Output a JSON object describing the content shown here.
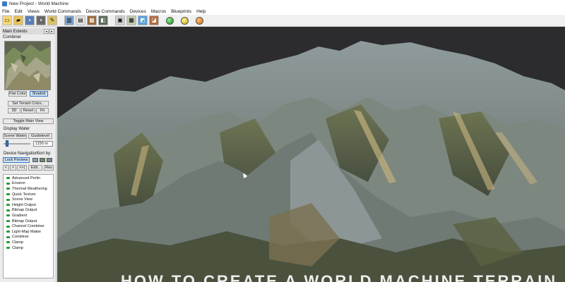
{
  "window": {
    "title": "New Project - World Machine"
  },
  "menu": [
    "File",
    "Edit",
    "Views",
    "World Commands",
    "Device Commands",
    "Devices",
    "Macros",
    "Blueprints",
    "Help"
  ],
  "toolbar": {
    "icons": [
      "new-icon",
      "open-icon",
      "save-icon",
      "save-as-icon",
      "device-icon",
      "layout-icon",
      "render-icon",
      "build-icon",
      "explorer-icon",
      "view-icon",
      "terrain-icon",
      "tiled-build-icon",
      "green-orb-icon",
      "yellow-orb-icon",
      "orange-orb-icon"
    ]
  },
  "left_panel": {
    "header": "Main Extents",
    "preview_label": "Combiner",
    "flat_color": "Flat Color",
    "shaded": "Shaded",
    "set_terrain_color": "Set Terrain Color...",
    "btn_3d": "3D",
    "btn_reset": "Reset",
    "btn_fit": "Fit",
    "toggle_main_view": "Toggle Main View",
    "display_water": "Display Water",
    "scene_water": "Scene Water",
    "guidelevel": "Guidelevel",
    "water_level": "1150 m",
    "device_navigation": "Device Navigation",
    "sort_by": "Sort by:",
    "lock_preview": "Lock Preview",
    "nav_prev": "<",
    "nav_next": ">",
    "nav_jump": ">>|",
    "edit": "Edit..",
    "reset_short": "Res",
    "devices": [
      "Advanced Perlin",
      "Erosion",
      "Thermal Weathering",
      "Quick Texture",
      "Scene View",
      "Height Output",
      "Bitmap Output",
      "Gradient",
      "Bitmap Output",
      "Channel Combiner",
      "Light-Map Maker",
      "Combiner",
      "Clamp",
      "Clamp"
    ]
  },
  "viewport": {
    "caption": "HOW TO CREATE A WORLD MACHINE TERRAIN",
    "background": "#2c2c2e"
  },
  "colors": {
    "accent": "#3a78c8",
    "device_dot": "#2c9a3a"
  }
}
